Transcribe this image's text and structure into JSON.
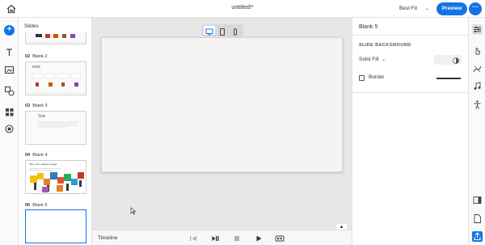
{
  "app": {
    "document_title": "untitled!*",
    "zoom": "Best Fit",
    "preview_label": "Preview",
    "more_label": "···"
  },
  "left_rail": {
    "icons": [
      "home-icon",
      "add-icon",
      "text-icon",
      "media-icon",
      "shapes-icon",
      "grid-icon",
      "record-icon"
    ]
  },
  "slides_panel": {
    "title": "Slides",
    "slides": [
      {
        "number": "02",
        "name": "Blank 2"
      },
      {
        "number": "03",
        "name": "Blank 3",
        "thumb_title": "Title"
      },
      {
        "number": "04",
        "name": "Blank 4",
        "thumb_heading": "Title of the diagram image"
      },
      {
        "number": "05",
        "name": "Blank 5"
      }
    ]
  },
  "canvas": {
    "view_modes": [
      "desktop-icon",
      "tablet-icon",
      "mobile-icon"
    ],
    "active_view": "desktop"
  },
  "timeline": {
    "label": "Timeline",
    "controls": [
      "skip-back-icon",
      "play-pause-icon",
      "stop-icon",
      "play-icon",
      "cc-icon"
    ]
  },
  "properties": {
    "title": "Blank 5",
    "section": "SLIDE BACKGROUND",
    "fill": "Solid Fill",
    "border_label": "Border",
    "border_checked": false
  },
  "right_rail": {
    "icons": [
      "properties-icon",
      "interactions-icon",
      "effects-icon",
      "audio-icon",
      "accessibility-icon",
      "panel-icon",
      "document-icon",
      "share-icon"
    ]
  },
  "colors": {
    "accent": "#1473e6",
    "slide_bg": "#f5f4f2",
    "canvas_bg": "#e7e7e7"
  }
}
